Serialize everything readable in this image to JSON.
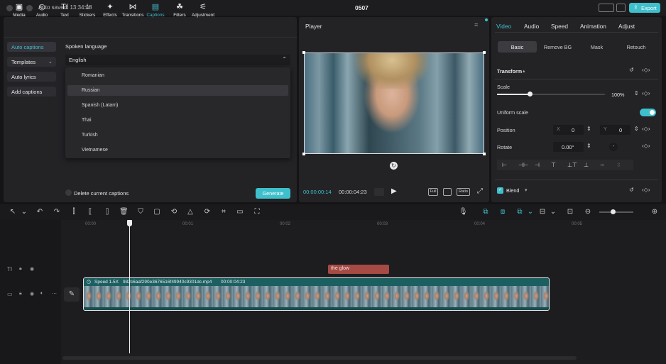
{
  "titlebar": {
    "autosave": "Auto saved: 13:34:18",
    "project": "0507",
    "export_label": "Export"
  },
  "toolbar": {
    "items": [
      {
        "label": "Media",
        "icon": "media-icon",
        "glyph": "▣"
      },
      {
        "label": "Audio",
        "icon": "audio-icon",
        "glyph": "◎"
      },
      {
        "label": "Text",
        "icon": "text-icon",
        "glyph": "TI"
      },
      {
        "label": "Stickers",
        "icon": "stickers-icon",
        "glyph": "☆"
      },
      {
        "label": "Effects",
        "icon": "effects-icon",
        "glyph": "✦"
      },
      {
        "label": "Transitions",
        "icon": "transitions-icon",
        "glyph": "⋈"
      },
      {
        "label": "Captions",
        "icon": "captions-icon",
        "glyph": "▤"
      },
      {
        "label": "Filters",
        "icon": "filters-icon",
        "glyph": "☘"
      },
      {
        "label": "Adjustment",
        "icon": "adjustment-icon",
        "glyph": "⚟"
      }
    ]
  },
  "captions": {
    "sidebar": [
      "Auto captions",
      "Templates",
      "Auto lyrics",
      "Add captions"
    ],
    "spoken_language_label": "Spoken language",
    "selected_language": "English",
    "options": [
      "Romanian",
      "Russian",
      "Spanish (Latam)",
      "Thai",
      "Turkish",
      "Vietnamese"
    ],
    "delete_label": "Delete current captions",
    "generate_label": "Generate"
  },
  "player": {
    "title": "Player",
    "current_time": "00:00:00:14",
    "total_time": "00:00:04:23",
    "full_label": "Full",
    "ratio_label": "Ratio"
  },
  "inspector": {
    "tabs": [
      "Video",
      "Audio",
      "Speed",
      "Animation",
      "Adjust"
    ],
    "subtabs": [
      "Basic",
      "Remove BG",
      "Mask",
      "Retouch"
    ],
    "transform_label": "Transform",
    "scale_label": "Scale",
    "scale_value": "100%",
    "scale_fraction": 0.3,
    "uniform_label": "Uniform scale",
    "position_label": "Position",
    "x_label": "X",
    "x_value": "0",
    "y_label": "Y",
    "y_value": "0",
    "rotate_label": "Rotate",
    "rotate_value": "0.00°",
    "rotate_dash": "-",
    "blend_label": "Blend"
  },
  "timeline": {
    "ticks": [
      "00:00",
      "00:01",
      "00:02",
      "00:03",
      "00:04",
      "00:05"
    ],
    "caption_clip": "the glow",
    "video_clip_speed": "Speed 1.5X",
    "video_clip_name": "982c6aaf290e3676516f49940c9301dc.mp4",
    "video_clip_duration": "00:00:04:23"
  },
  "colors": {
    "accent": "#3fbfcc",
    "caption_clip": "#a54a44",
    "video_clip": "#1f6b6d"
  }
}
